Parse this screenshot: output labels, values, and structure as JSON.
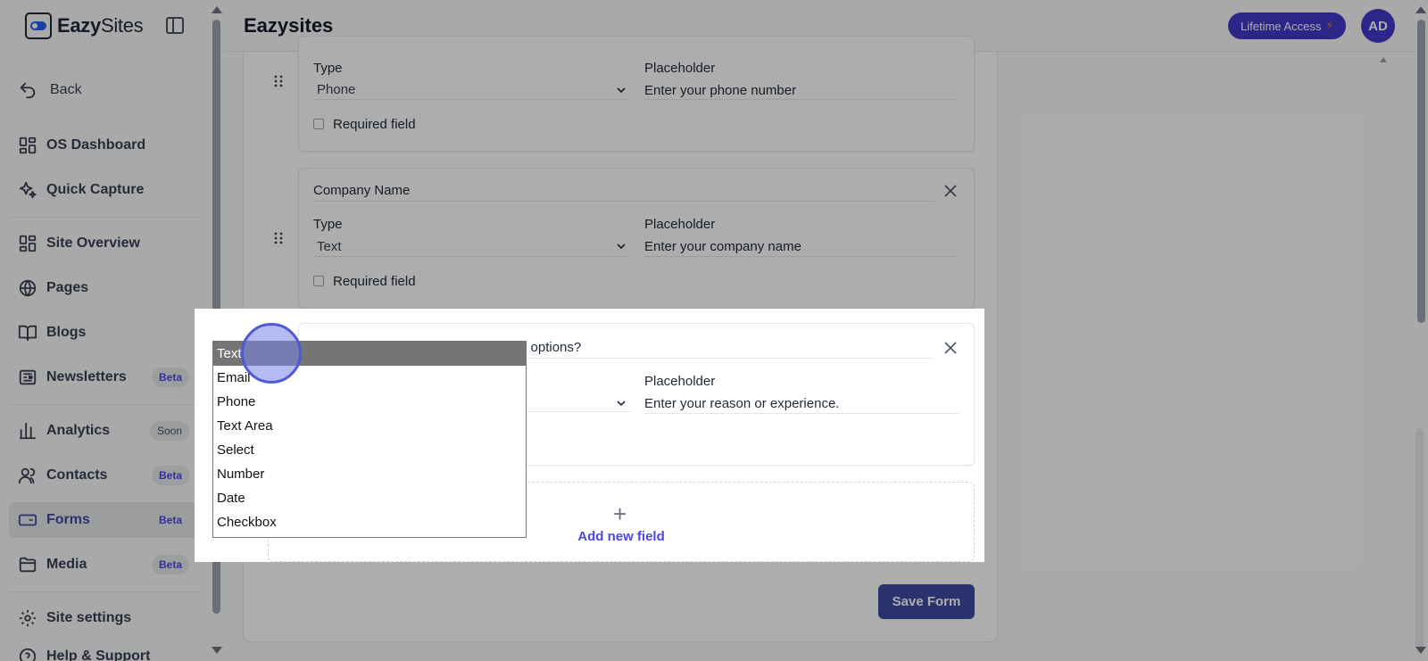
{
  "sidebar": {
    "logo_bold": "Eazy",
    "logo_rest": "Sites",
    "back_label": "Back",
    "items": [
      {
        "label": "OS Dashboard",
        "badge": ""
      },
      {
        "label": "Quick Capture",
        "badge": ""
      },
      {
        "label": "Site Overview",
        "badge": ""
      },
      {
        "label": "Pages",
        "badge": ""
      },
      {
        "label": "Blogs",
        "badge": ""
      },
      {
        "label": "Newsletters",
        "badge": "Beta"
      },
      {
        "label": "Analytics",
        "badge": "Soon"
      },
      {
        "label": "Contacts",
        "badge": "Beta"
      },
      {
        "label": "Forms",
        "badge": "Beta"
      },
      {
        "label": "Media",
        "badge": "Beta"
      },
      {
        "label": "Site settings",
        "badge": ""
      },
      {
        "label": "Help & Support",
        "badge": ""
      }
    ]
  },
  "header": {
    "title": "Eazysites",
    "lifetime_label": "Lifetime Access",
    "avatar_initials": "AD"
  },
  "form": {
    "fields": [
      {
        "label": "",
        "type_label": "Type",
        "type_value": "Phone",
        "placeholder_label": "Placeholder",
        "placeholder_value": "Enter your phone number",
        "required_label": "Required field"
      },
      {
        "label": "Company Name",
        "type_label": "Type",
        "type_value": "Text",
        "placeholder_label": "Placeholder",
        "placeholder_value": "Enter your company name",
        "required_label": "Required field"
      },
      {
        "label": "er options?",
        "type_label": "",
        "type_value": "",
        "placeholder_label": "Placeholder",
        "placeholder_value": "Enter your reason or experience.",
        "required_label": ""
      }
    ],
    "add_field_label": "Add new field",
    "save_label": "Save Form"
  },
  "dropdown": {
    "options": [
      "Text",
      "Email",
      "Phone",
      "Text Area",
      "Select",
      "Number",
      "Date",
      "Checkbox"
    ],
    "selected": "Text"
  }
}
